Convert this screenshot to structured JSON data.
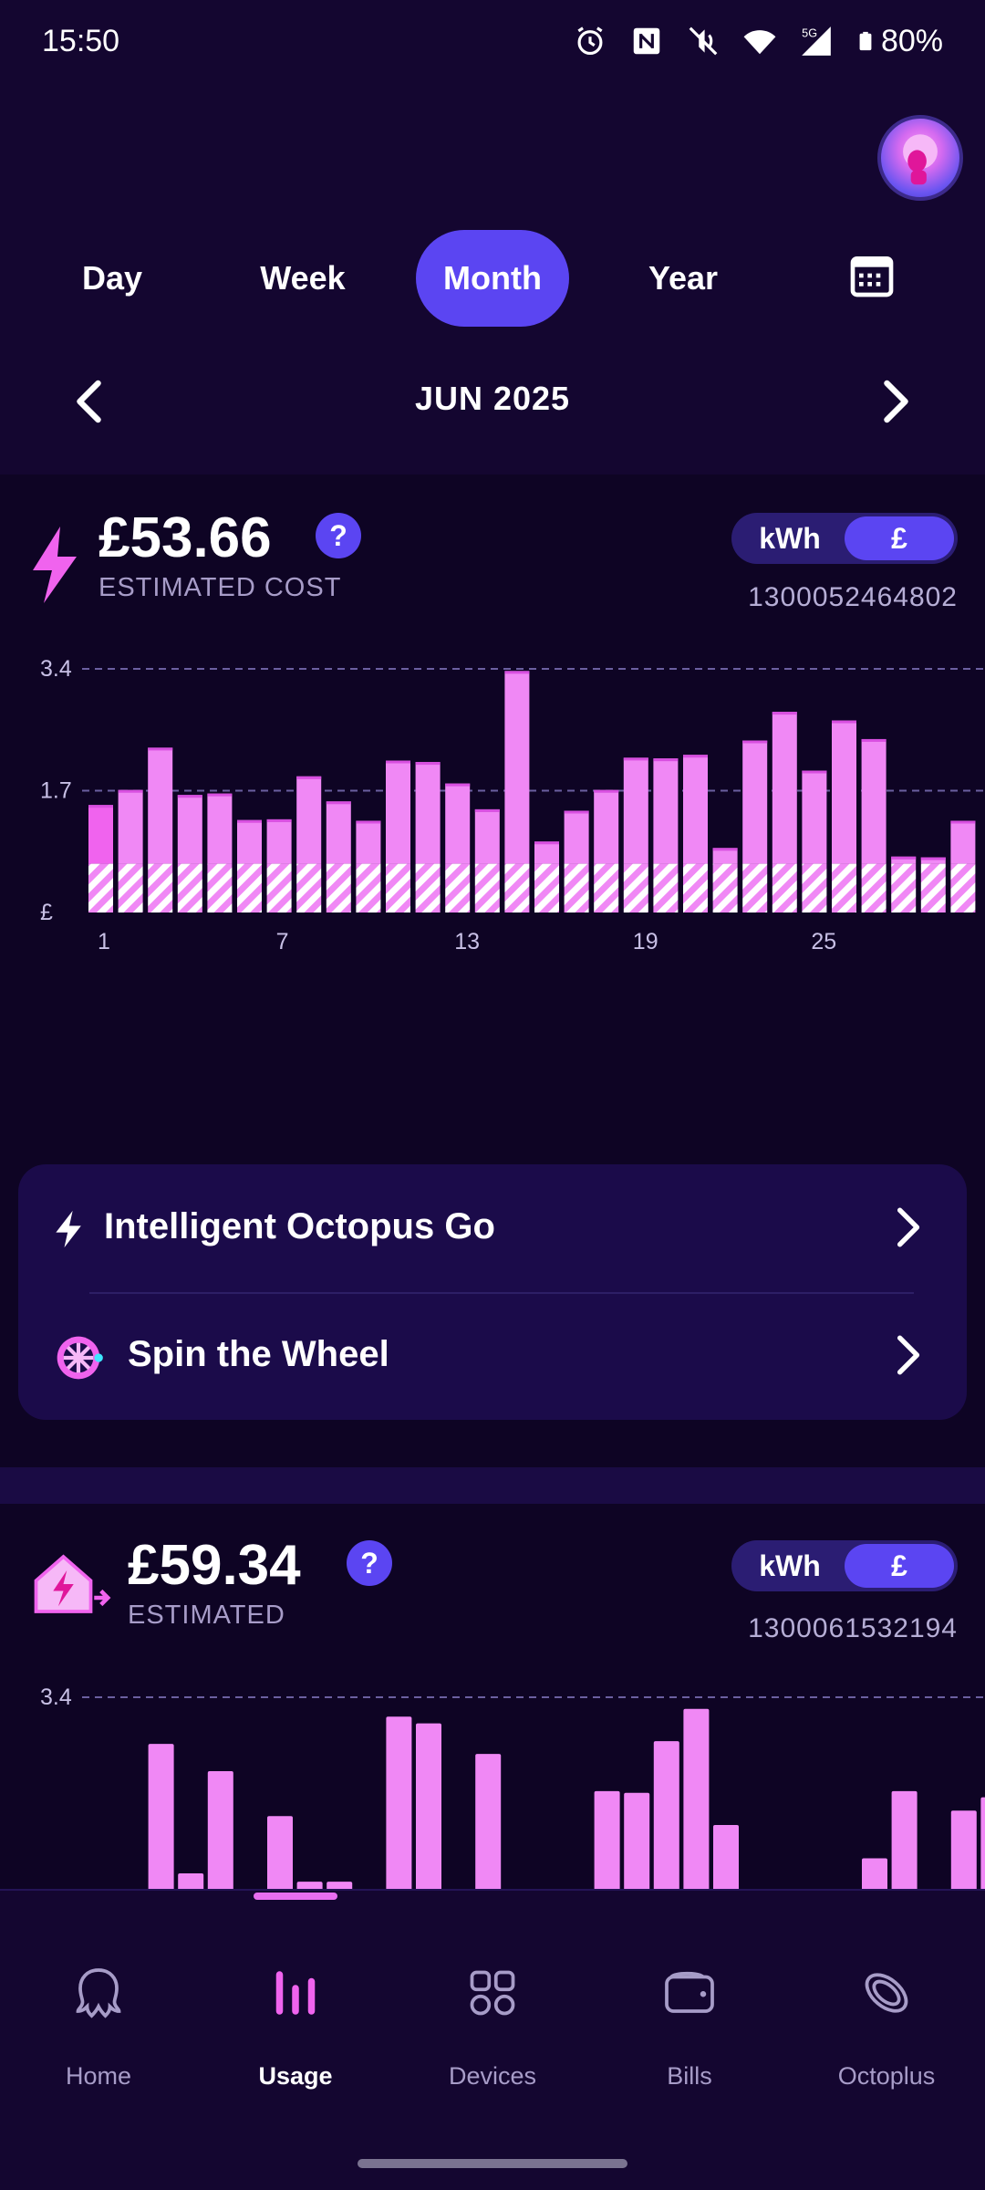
{
  "status_bar": {
    "time": "15:50",
    "battery": "80%"
  },
  "tabs": [
    {
      "label": "Day",
      "active": false
    },
    {
      "label": "Week",
      "active": false
    },
    {
      "label": "Month",
      "active": true
    },
    {
      "label": "Year",
      "active": false
    }
  ],
  "period": {
    "label": "JUN 2025"
  },
  "electricity": {
    "cost": "£53.66",
    "subtitle": "ESTIMATED COST",
    "help": "?",
    "unit_options": [
      "kWh",
      "£"
    ],
    "selected_unit": "£",
    "meter_id": "1300052464802"
  },
  "gas": {
    "cost": "£59.34",
    "subtitle": "ESTIMATED",
    "help": "?",
    "unit_options": [
      "kWh",
      "£"
    ],
    "selected_unit": "£",
    "meter_id": "1300061532194"
  },
  "links": [
    {
      "label": "Intelligent Octopus Go",
      "icon": "lightning-icon"
    },
    {
      "label": "Spin the Wheel",
      "icon": "wheel-icon"
    }
  ],
  "bottom_nav": [
    {
      "label": "Home",
      "icon": "octopus-icon",
      "active": false
    },
    {
      "label": "Usage",
      "icon": "bar-chart-icon",
      "active": true
    },
    {
      "label": "Devices",
      "icon": "grid-icon",
      "active": false
    },
    {
      "label": "Bills",
      "icon": "wallet-icon",
      "active": false
    },
    {
      "label": "Octoplus",
      "icon": "octoplus-icon",
      "active": false
    }
  ],
  "colors": {
    "background": "#140630",
    "accent": "#5b45f2",
    "bar": "#f088f5",
    "bar_highlight": "#f063ee"
  },
  "chart_data": [
    {
      "type": "bar",
      "title": "",
      "y_tick_labels": [
        "3.4",
        "1.7",
        "£"
      ],
      "ylim": [
        0,
        3.4
      ],
      "x": [
        1,
        2,
        3,
        4,
        5,
        6,
        7,
        8,
        9,
        10,
        11,
        12,
        13,
        14,
        15,
        16,
        17,
        18,
        19,
        20,
        21,
        22,
        23,
        24,
        25,
        26,
        27,
        28,
        29,
        30
      ],
      "x_tick_labels": [
        "1",
        "7",
        "13",
        "19",
        "25"
      ],
      "standing_charge": 0.68,
      "values": [
        1.5,
        1.71,
        2.3,
        1.64,
        1.66,
        1.29,
        1.3,
        1.9,
        1.55,
        1.28,
        2.12,
        2.1,
        1.8,
        1.44,
        3.37,
        0.99,
        1.42,
        1.71,
        2.16,
        2.15,
        2.2,
        0.9,
        2.4,
        2.8,
        1.98,
        2.68,
        2.42,
        0.78,
        0.77,
        1.28
      ],
      "grid": "dashed horizontal"
    },
    {
      "type": "bar",
      "title": "",
      "y_tick_labels": [
        "3.4"
      ],
      "ylim": [
        0,
        3.4
      ],
      "x": [
        1,
        2,
        3,
        4,
        5,
        6,
        7,
        8,
        9,
        10,
        11,
        12,
        13,
        14,
        15,
        16,
        17,
        18,
        19,
        20,
        21,
        22,
        23,
        24,
        25,
        26,
        27,
        28,
        29,
        30
      ],
      "visible_tops": [
        null,
        2.56,
        0.23,
        2.07,
        null,
        1.26,
        0.08,
        0.08,
        null,
        3.05,
        2.93,
        null,
        2.38,
        null,
        null,
        null,
        1.71,
        1.68,
        2.61,
        3.19,
        1.1,
        null,
        null,
        null,
        null,
        0.5,
        1.71,
        null,
        1.36,
        1.6
      ],
      "grid": "dashed horizontal"
    }
  ]
}
